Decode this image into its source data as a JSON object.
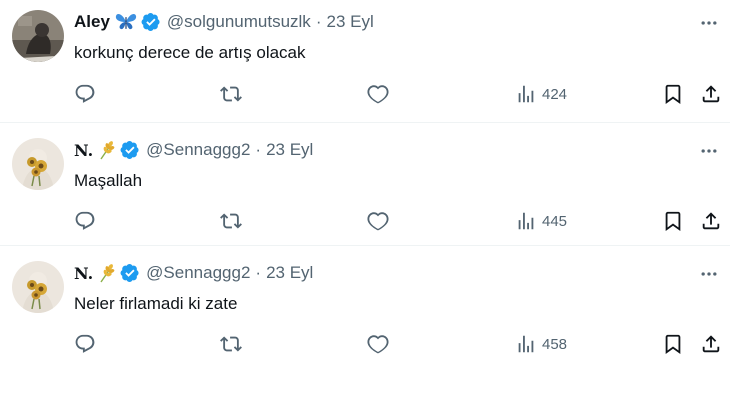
{
  "tweets": [
    {
      "name": "Aley",
      "name_emoji": "butterfly-emoji",
      "handle": "@solgunumutsuzlk",
      "separator": "·",
      "date": "23 Eyl",
      "text": "korkunç derece de artış olacak",
      "views": "424",
      "verified_color": "#1d9bf0"
    },
    {
      "name": "N.",
      "name_emoji": "wheat-emoji",
      "handle": "@Sennaggg2",
      "separator": "·",
      "date": "23 Eyl",
      "text": "Maşallah",
      "views": "445",
      "verified_color": "#1d9bf0"
    },
    {
      "name": "N.",
      "name_emoji": "wheat-emoji",
      "handle": "@Sennaggg2",
      "separator": "·",
      "date": "23 Eyl",
      "text": "Neler firlamadi ki zate",
      "views": "458",
      "verified_color": "#1d9bf0"
    }
  ],
  "icons": {
    "reply": "reply-icon",
    "retweet": "retweet-icon",
    "like": "like-icon",
    "views": "views-icon",
    "bookmark": "bookmark-icon",
    "share": "share-icon",
    "more": "more-icon"
  },
  "colors": {
    "text": "#0f1419",
    "secondary": "#536471",
    "divider": "#eff3f4",
    "verified": "#1d9bf0"
  }
}
